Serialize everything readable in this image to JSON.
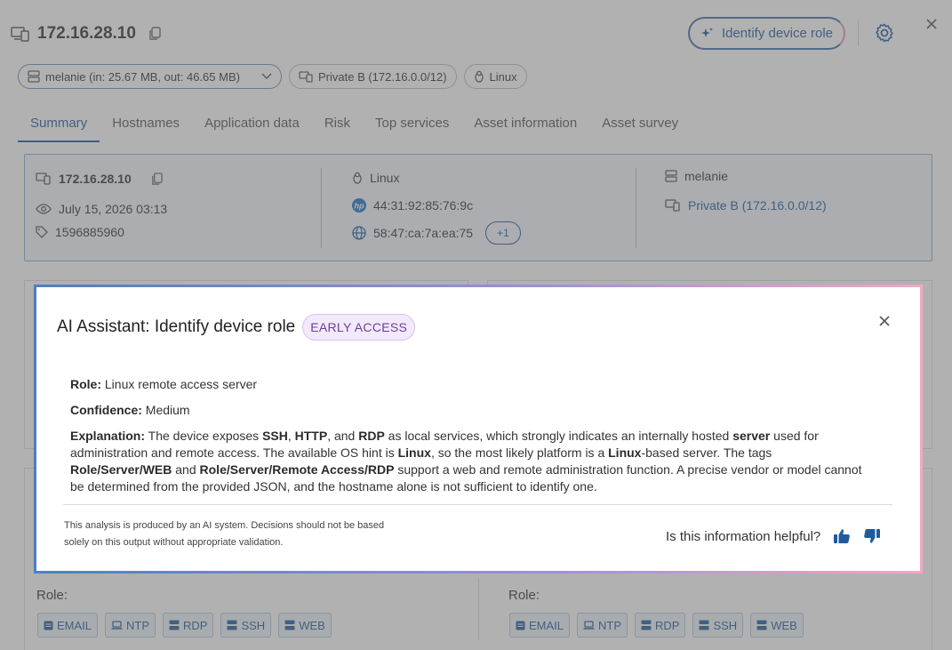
{
  "header": {
    "ip": "172.16.28.10",
    "identify_button": "Identify device role"
  },
  "chips": {
    "sensor": "melanie (in: 25.67 MB, out: 46.65 MB)",
    "network": "Private B (172.16.0.0/12)",
    "os": "Linux"
  },
  "tabs": [
    "Summary",
    "Hostnames",
    "Application data",
    "Risk",
    "Top services",
    "Asset information",
    "Asset survey"
  ],
  "summary": {
    "ip": "172.16.28.10",
    "last_seen": "July 15, 2026 03:13",
    "id": "1596885960",
    "os": "Linux",
    "mac1": "44:31:92:85:76:9c",
    "mac2": "58:47:ca:7a:ea:75",
    "more": "+1",
    "sensor": "melanie",
    "network": "Private B (172.16.0.0/12)"
  },
  "cards": {
    "left": {
      "role_label": "Role:",
      "tags": [
        "EMAIL",
        "NTP",
        "RDP",
        "SSH",
        "WEB"
      ]
    },
    "right": {
      "role_label": "Role:",
      "tags": [
        "EMAIL",
        "NTP",
        "RDP",
        "SSH",
        "WEB"
      ]
    }
  },
  "modal": {
    "title": "AI Assistant: Identify device role",
    "badge": "EARLY ACCESS",
    "role_label": "Role:",
    "role_value": "Linux remote access server",
    "confidence_label": "Confidence:",
    "confidence_value": "Medium",
    "explanation_label": "Explanation:",
    "exp": {
      "t1": "The device exposes ",
      "b1": "SSH",
      "t2": ", ",
      "b2": "HTTP",
      "t3": ", and ",
      "b3": "RDP",
      "t4": " as local services, which strongly indicates an internally hosted ",
      "b4": "server",
      "t5": " used for administration and remote access. The available OS hint is ",
      "b5": "Linux",
      "t6": ", so the most likely platform is a ",
      "b6": "Linux",
      "t7": "-based server. The tags ",
      "b7": "Role/Server/WEB",
      "t8": " and ",
      "b8": "Role/Server/Remote Access/RDP",
      "t9": " support a web and remote administration function. A precise vendor or model cannot be determined from the provided JSON, and the hostname alone is not sufficient to identify one."
    },
    "disclaimer": "This analysis is produced by an AI system. Decisions should not be based solely on this output without appropriate validation.",
    "helpful_question": "Is this information helpful?"
  },
  "colors": {
    "accent": "#1f5b9e",
    "summary_bg": "#f2f7fc",
    "badge_text": "#6b3fa0",
    "gradient_start": "#4f7fc2",
    "gradient_end": "#f3a6c4"
  }
}
